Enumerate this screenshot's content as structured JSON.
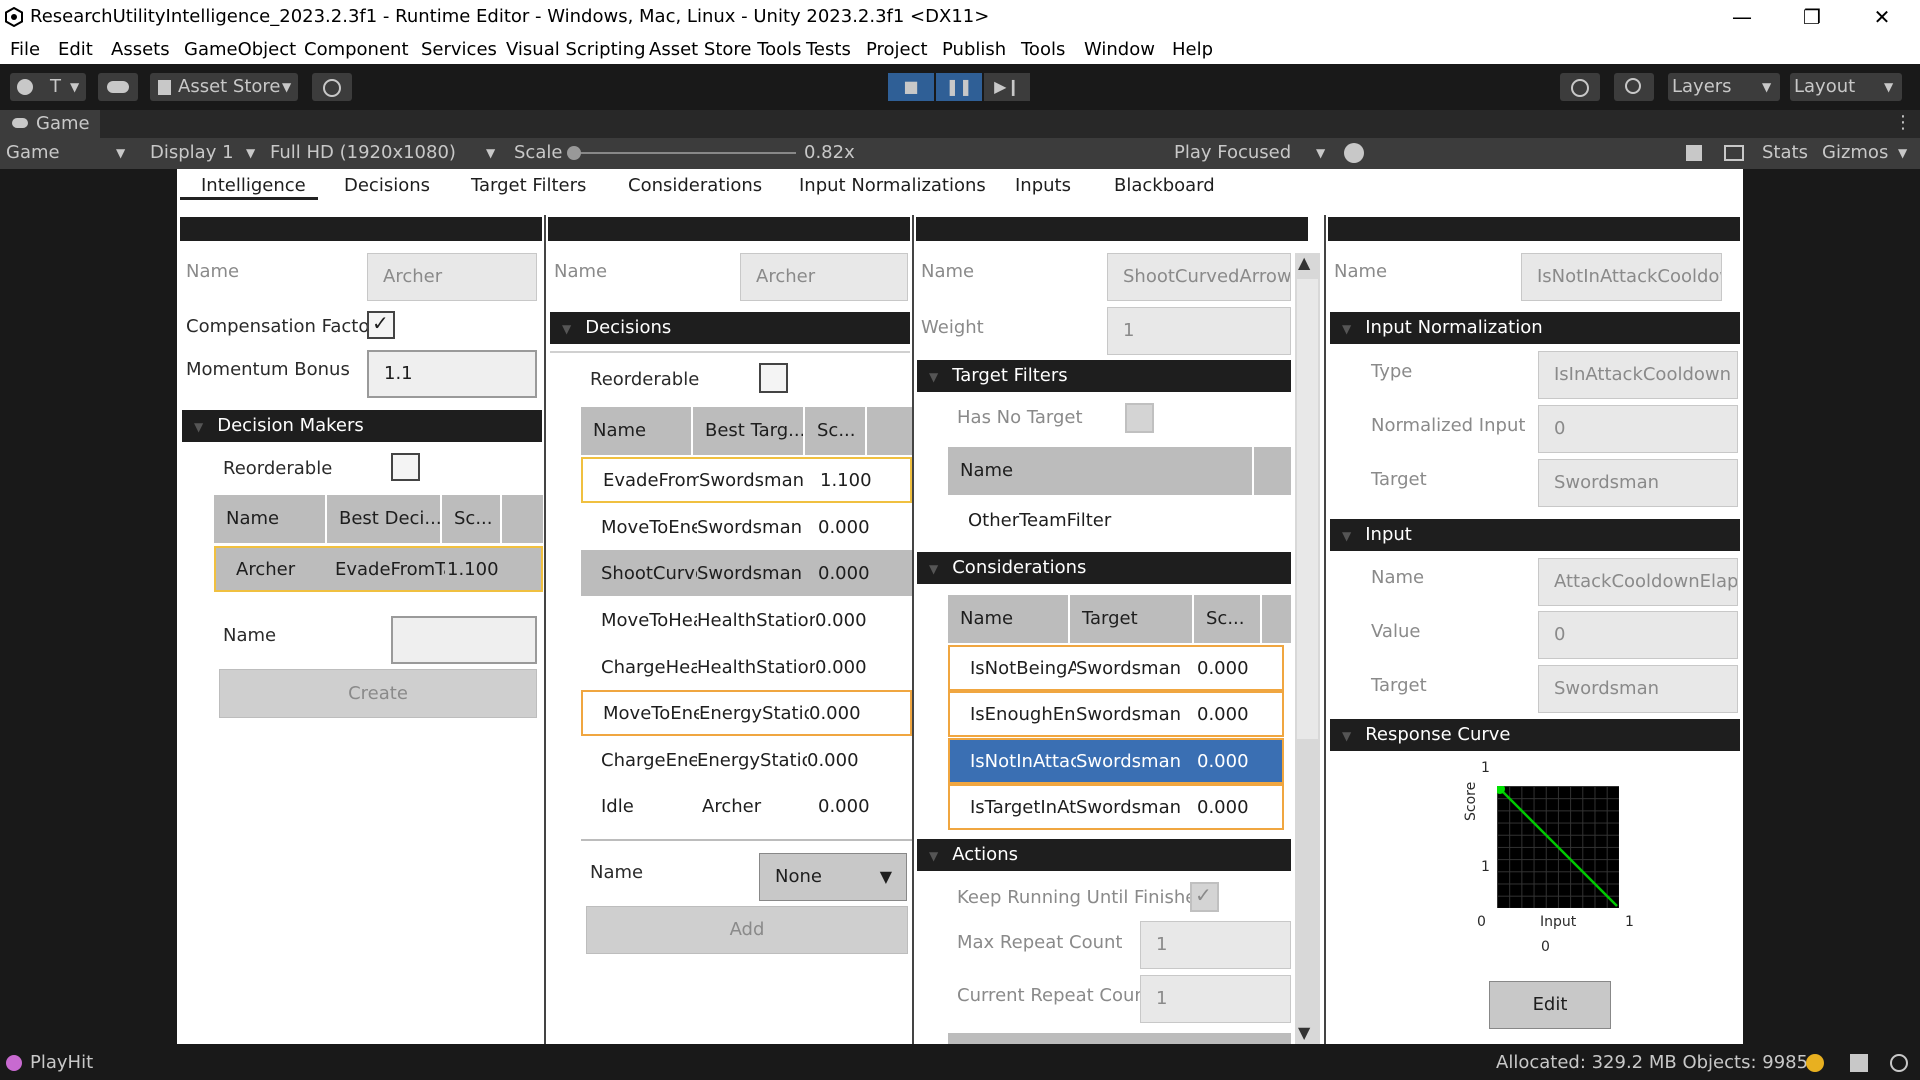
{
  "window": {
    "title": "ResearchUtilityIntelligence_2023.2.3f1 - Runtime Editor - Windows, Mac, Linux - Unity 2023.2.3f1 <DX11>",
    "minimize": "—",
    "restore": "❐",
    "close": "✕"
  },
  "menu": [
    "File",
    "Edit",
    "Assets",
    "GameObject",
    "Component",
    "Services",
    "Visual Scripting",
    "Asset Store Tools",
    "Tests",
    "Project",
    "Publish",
    "Tools",
    "Window",
    "Help"
  ],
  "toolbar": {
    "account": "T",
    "asset_store": "Asset Store",
    "layers": "Layers",
    "layout": "Layout",
    "stop_icon": "■",
    "pause_icon": "❚❚",
    "step_icon": "▶❙"
  },
  "game_tab": {
    "label": "Game",
    "kebab": "⋮"
  },
  "game_toolbar": {
    "mode": "Game",
    "display": "Display 1",
    "resolution": "Full HD (1920x1080)",
    "scale_label": "Scale",
    "scale_value": "0.82x",
    "scale_fraction": 0.0,
    "play_focused": "Play Focused",
    "stats": "Stats",
    "gizmos": "Gizmos"
  },
  "tabs": [
    "Intelligence",
    "Decisions",
    "Target Filters",
    "Considerations",
    "Input Normalizations",
    "Inputs",
    "Blackboard"
  ],
  "col1": {
    "name_label": "Name",
    "name_value": "Archer",
    "comp_factor_label": "Compensation Factor",
    "comp_factor_checked": "✓",
    "momentum_label": "Momentum Bonus",
    "momentum_value": "1.1",
    "decision_makers_header": "Decision Makers",
    "reorderable_label": "Reorderable",
    "table_headers": [
      "Name",
      "Best Deci...",
      "Sc..."
    ],
    "rows": [
      [
        "Archer",
        "EvadeFromTa",
        "1.100"
      ]
    ],
    "new_name_label": "Name",
    "create_button": "Create"
  },
  "col2": {
    "name_label": "Name",
    "name_value": "Archer",
    "decisions_header": "Decisions",
    "reorderable_label": "Reorderable",
    "table_headers": [
      "Name",
      "Best Targ...",
      "Sc..."
    ],
    "rows": [
      [
        "EvadeFrom",
        "Swordsman",
        "1.100"
      ],
      [
        "MoveToEne",
        "Swordsman",
        "0.000"
      ],
      [
        "ShootCurve",
        "Swordsman",
        "0.000"
      ],
      [
        "MoveToHea",
        "HealthStation",
        "0.000"
      ],
      [
        "ChargeHeal",
        "HealthStation",
        "0.000"
      ],
      [
        "MoveToEne",
        "EnergyStation",
        "0.000"
      ],
      [
        "ChargeEner",
        "EnergyStation",
        "0.000"
      ],
      [
        "Idle",
        "Archer",
        "0.000"
      ]
    ],
    "add_name_label": "Name",
    "dropdown_value": "None",
    "add_button": "Add"
  },
  "col3": {
    "name_label": "Name",
    "name_value": "ShootCurvedArrow",
    "weight_label": "Weight",
    "weight_value": "1",
    "target_filters_header": "Target Filters",
    "has_no_target_label": "Has No Target",
    "filters_header": "Name",
    "filters": [
      "OtherTeamFilter"
    ],
    "considerations_header": "Considerations",
    "cons_headers": [
      "Name",
      "Target",
      "Sc..."
    ],
    "cons_rows": [
      [
        "IsNotBeingA",
        "Swordsman",
        "0.000"
      ],
      [
        "IsEnoughEne",
        "Swordsman",
        "0.000"
      ],
      [
        "IsNotInAttac",
        "Swordsman",
        "0.000"
      ],
      [
        "IsTargetInAtt",
        "Swordsman",
        "0.000"
      ]
    ],
    "actions_header": "Actions",
    "keep_running_label": "Keep Running Until Finished",
    "keep_running_checked": "✓",
    "max_repeat_label": "Max Repeat Count",
    "max_repeat_value": "1",
    "current_repeat_label": "Current Repeat Count",
    "current_repeat_value": "1",
    "scroll_up": "▲",
    "scroll_down": "▼"
  },
  "col4": {
    "name_label": "Name",
    "name_value": "IsNotInAttackCooldown",
    "input_norm_header": "Input Normalization",
    "type_label": "Type",
    "type_value": "IsInAttackCooldown",
    "normalized_input_label": "Normalized Input",
    "normalized_input_value": "0",
    "target_label": "Target",
    "target_value": "Swordsman",
    "input_header": "Input",
    "input_name_label": "Name",
    "input_name_value": "AttackCooldownElapsed",
    "value_label": "Value",
    "value_value": "0",
    "input_target_label": "Target",
    "input_target_value": "Swordsman",
    "response_curve_header": "Response Curve",
    "curve": {
      "y_top": "1",
      "y_mid": "1",
      "y_label": "Score",
      "x_left": "0",
      "x_label": "Input",
      "x_right": "1",
      "x_below": "0",
      "line_color": "#00c800"
    },
    "edit_button": "Edit"
  },
  "statusbar": {
    "app": "PlayHit",
    "allocated": "Allocated: 329.2 MB Objects: 9985"
  }
}
